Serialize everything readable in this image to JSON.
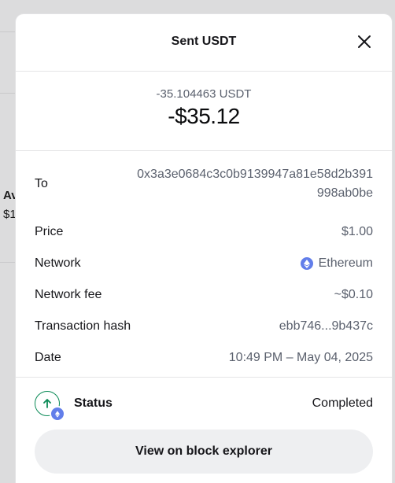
{
  "backdrop": {
    "text1": "Av",
    "text2": "$1"
  },
  "modal": {
    "title": "Sent USDT",
    "crypto_amount": "-35.104463 USDT",
    "fiat_amount": "-$35.12",
    "details": {
      "to_label": "To",
      "to_value": "0x3a3e0684c3c0b9139947a81e58d2b391998ab0be",
      "price_label": "Price",
      "price_value": "$1.00",
      "network_label": "Network",
      "network_value": "Ethereum",
      "fee_label": "Network fee",
      "fee_value": "~$0.10",
      "hash_label": "Transaction hash",
      "hash_value": "ebb746...9b437c",
      "date_label": "Date",
      "date_value": "10:49 PM – May 04, 2025"
    },
    "status": {
      "label": "Status",
      "value": "Completed"
    },
    "explorer_button": "View on block explorer"
  },
  "icons": {
    "close": "close-icon",
    "network": "ethereum-icon",
    "status": "sent-arrow-icon"
  },
  "colors": {
    "ethereum": "#627eea",
    "status_green": "#0a8a56",
    "button_bg": "#eeeff1"
  }
}
